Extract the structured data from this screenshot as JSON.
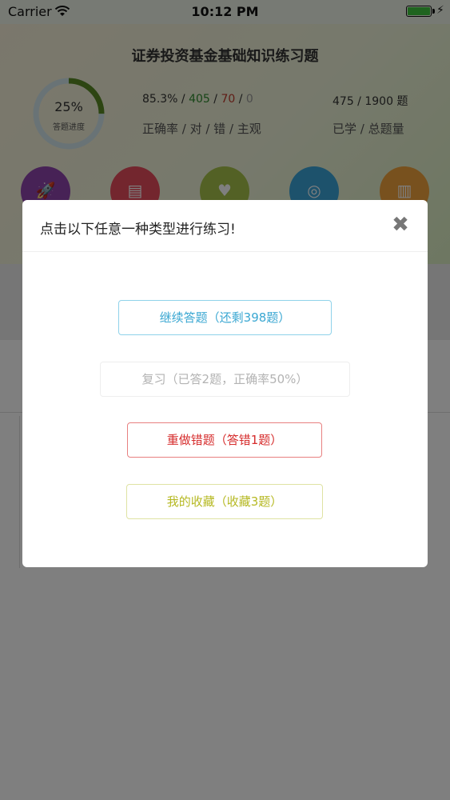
{
  "status_bar": {
    "carrier": "Carrier",
    "time": "10:12 PM"
  },
  "header": {
    "title": "证券投资基金基础知识练习题",
    "progress_percent": "25%",
    "progress_caption": "答题进度",
    "progress_value": 0.25,
    "accuracy": "85.3%",
    "correct": "405",
    "wrong": "70",
    "subjective": "0",
    "stats_left_caption": "正确率 / 对 / 错 / 主观",
    "learned": "475",
    "total": "1900",
    "total_suffix": "题",
    "stats_right_caption": "已学 / 总题量"
  },
  "categories": [
    {
      "icon": "rocket-icon",
      "color": "#8e44ad"
    },
    {
      "icon": "document-icon",
      "color": "#e74c5c"
    },
    {
      "icon": "heart-icon",
      "color": "#a6c34a"
    },
    {
      "icon": "steering-wheel-icon",
      "color": "#3ba5d8"
    },
    {
      "icon": "bar-chart-icon",
      "color": "#f0a23c"
    }
  ],
  "modal": {
    "title": "点击以下任意一种类型进行练习!",
    "options": {
      "continue": "继续答题（还剩398题）",
      "review": "复习（已答2题，正确率50%）",
      "redo": "重做错题（答错1题）",
      "favorites": "我的收藏（收藏3题）"
    }
  },
  "colors": {
    "continue": "#3aa7d2",
    "review": "#b3b3b3",
    "redo": "#d62d2d",
    "favorites": "#b6b923"
  }
}
